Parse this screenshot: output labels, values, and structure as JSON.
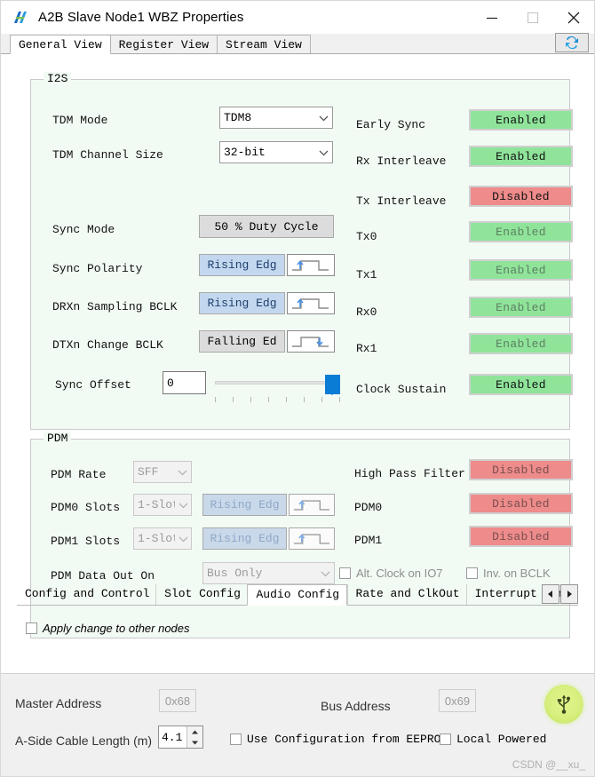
{
  "window": {
    "title": "A2B Slave Node1 WBZ Properties",
    "icon": "a2b-app-icon",
    "controls": {
      "minimize": "–",
      "maximize": "□",
      "close": "✕"
    }
  },
  "top_tabs": {
    "items": [
      {
        "label": "General View",
        "active": true
      },
      {
        "label": "Register View",
        "active": false
      },
      {
        "label": "Stream View",
        "active": false
      }
    ],
    "refresh_icon": "refresh-icon"
  },
  "i2s": {
    "legend": "I2S",
    "tdm_mode": {
      "label": "TDM Mode",
      "value": "TDM8"
    },
    "tdm_channel_size": {
      "label": "TDM Channel Size",
      "value": "32-bit"
    },
    "sync_mode": {
      "label": "Sync Mode",
      "value": "50 % Duty Cycle"
    },
    "sync_polarity": {
      "label": "Sync Polarity",
      "value": "Rising Edg",
      "edge": "rising"
    },
    "drxn_sampling_bclk": {
      "label": "DRXn Sampling BCLK",
      "value": "Rising Edg",
      "edge": "rising"
    },
    "dtxn_change_bclk": {
      "label": "DTXn Change BCLK",
      "value": "Falling Ed",
      "edge": "falling"
    },
    "sync_offset": {
      "label": "Sync Offset",
      "value": "0",
      "slider_percent": 100
    },
    "status": [
      {
        "label": "Early Sync",
        "value": "Enabled",
        "state": "enabled",
        "muted": false
      },
      {
        "label": "Rx Interleave",
        "value": "Enabled",
        "state": "enabled",
        "muted": false
      },
      {
        "label": "Tx Interleave",
        "value": "Disabled",
        "state": "disabled",
        "muted": false
      },
      {
        "label": "Tx0",
        "value": "Enabled",
        "state": "enabled",
        "muted": true
      },
      {
        "label": "Tx1",
        "value": "Enabled",
        "state": "enabled",
        "muted": true
      },
      {
        "label": "Rx0",
        "value": "Enabled",
        "state": "enabled",
        "muted": true
      },
      {
        "label": "Rx1",
        "value": "Enabled",
        "state": "enabled",
        "muted": true
      },
      {
        "label": "Clock Sustain",
        "value": "Enabled",
        "state": "enabled",
        "muted": false
      }
    ]
  },
  "pdm": {
    "legend": "PDM",
    "pdm_rate": {
      "label": "PDM Rate",
      "value": "SFF"
    },
    "pdm0_slots": {
      "label": "PDM0 Slots",
      "value": "1-Slot",
      "edge_label": "Rising Edg",
      "edge": "rising"
    },
    "pdm1_slots": {
      "label": "PDM1 Slots",
      "value": "1-Slot",
      "edge_label": "Rising Edg",
      "edge": "rising"
    },
    "pdm_data_out_on": {
      "label": "PDM Data Out On",
      "value": "Bus Only"
    },
    "alt_clock_io7": {
      "label": "Alt. Clock on IO7",
      "checked": false
    },
    "inv_on_bclk": {
      "label": "Inv. on BCLK",
      "checked": false
    },
    "status": [
      {
        "label": "High Pass Filter",
        "value": "Disabled",
        "state": "disabled",
        "muted": true
      },
      {
        "label": "PDM0",
        "value": "Disabled",
        "state": "disabled",
        "muted": true
      },
      {
        "label": "PDM1",
        "value": "Disabled",
        "state": "disabled",
        "muted": true
      }
    ]
  },
  "bottom_tabs": {
    "items": [
      {
        "label": "Config and Control",
        "active": false
      },
      {
        "label": "Slot Config",
        "active": false
      },
      {
        "label": "Audio Config",
        "active": true
      },
      {
        "label": "Rate and ClkOut",
        "active": false
      },
      {
        "label": "Interrupt Conf",
        "active": false
      }
    ],
    "scroll_left_icon": "chevron-left-icon",
    "scroll_right_icon": "chevron-right-icon"
  },
  "apply_change": {
    "label": "Apply change to other nodes",
    "checked": false
  },
  "footer": {
    "master_address": {
      "label": "Master Address",
      "value": "0x68"
    },
    "bus_address": {
      "label": "Bus Address",
      "value": "0x69"
    },
    "cable_length": {
      "label": "A-Side Cable Length (m)",
      "value": "4.1"
    },
    "use_config_eeprom": {
      "label": "Use Configuration from EEPROM",
      "checked": false
    },
    "local_powered": {
      "label": "Local Powered",
      "checked": false
    },
    "usb_icon": "usb-icon"
  },
  "watermark": "CSDN @__xu_",
  "colors": {
    "enabled_bg": "#8fe49a",
    "disabled_bg": "#ee8b8b",
    "accent_blue": "#0a7cd6",
    "group_bg": "#f2faf4",
    "toggle_blue": "#c3d8ef"
  }
}
